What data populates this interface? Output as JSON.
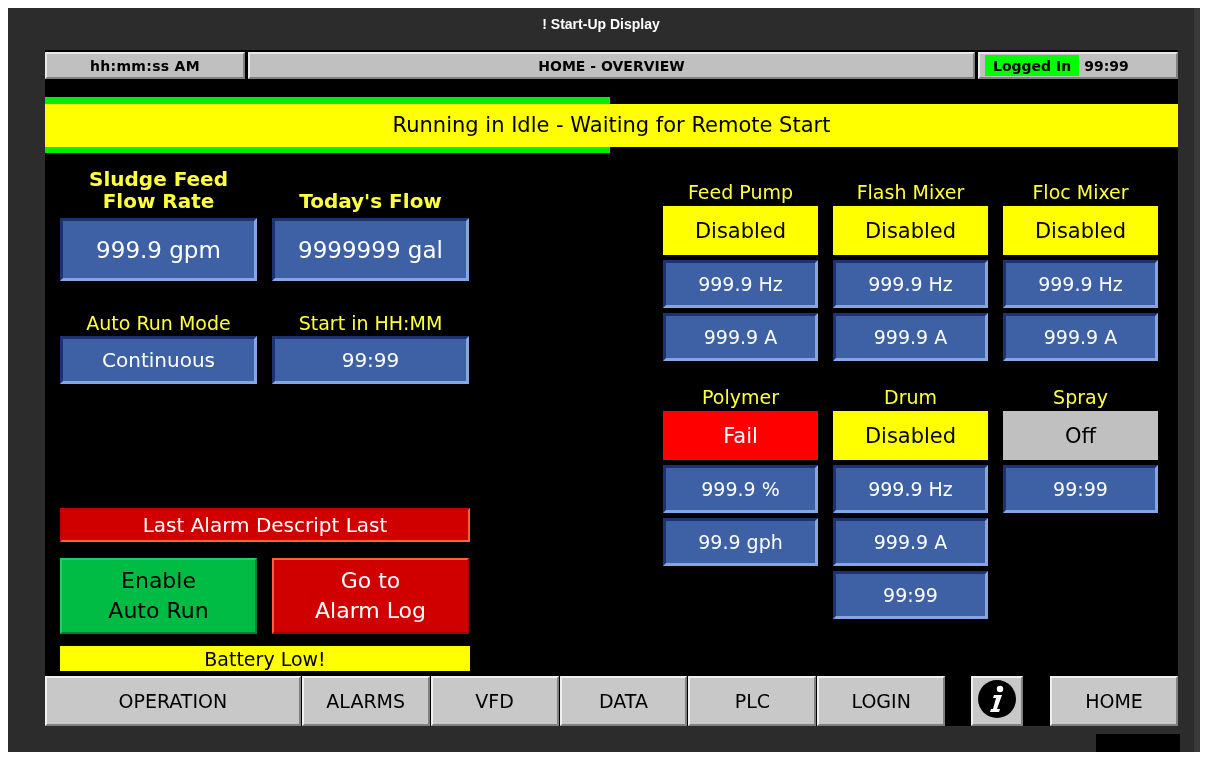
{
  "window": {
    "title": "! Start-Up Display"
  },
  "header": {
    "time": "hh:mm:ss AM",
    "screen_title": "HOME - OVERVIEW",
    "login": {
      "label": "Logged In",
      "on": true
    },
    "timer": "99:99"
  },
  "banner": {
    "message": "Running in Idle - Waiting for Remote Start"
  },
  "readouts": [
    {
      "label": "Sludge Feed\nFlow Rate",
      "value": "999.9 gpm",
      "kind": "large"
    },
    {
      "label": "Today's Flow",
      "value": "9999999 gal",
      "kind": "large"
    },
    {
      "label": "Auto Run Mode",
      "value": "Continuous",
      "kind": "small"
    },
    {
      "label": "Start in HH:MM",
      "value": "99:99",
      "kind": "small"
    }
  ],
  "last_alarm": "Last Alarm Descript Last",
  "actions": [
    {
      "label": "Enable\nAuto Run",
      "kind": "enable"
    },
    {
      "label": "Go to\nAlarm Log",
      "kind": "alarm"
    }
  ],
  "warning": "Battery Low!",
  "equipment": [
    {
      "name": "Feed Pump",
      "status": "Disabled",
      "color": "#ffff00",
      "values": [
        "999.9 Hz",
        "999.9 A"
      ]
    },
    {
      "name": "Flash Mixer",
      "status": "Disabled",
      "color": "#ffff00",
      "values": [
        "999.9 Hz",
        "999.9 A"
      ]
    },
    {
      "name": "Floc Mixer",
      "status": "Disabled",
      "color": "#ffff00",
      "values": [
        "999.9 Hz",
        "999.9 A"
      ]
    },
    {
      "name": "Polymer",
      "status": "Fail",
      "color": "#ff0000",
      "values": [
        "999.9 %",
        "99.9 gph"
      ]
    },
    {
      "name": "Drum",
      "status": "Disabled",
      "color": "#ffff00",
      "values": [
        "999.9 Hz",
        "999.9 A",
        "99:99"
      ]
    },
    {
      "name": "Spray",
      "status": "Off",
      "color": "#c0c0c0",
      "values": [
        "99:99"
      ]
    }
  ],
  "nav": [
    {
      "label": "OPERATION",
      "kind": "wide"
    },
    {
      "label": "ALARMS",
      "kind": "normal"
    },
    {
      "label": "VFD",
      "kind": "normal"
    },
    {
      "label": "DATA",
      "kind": "normal"
    },
    {
      "label": "PLC",
      "kind": "normal"
    },
    {
      "label": "LOGIN",
      "kind": "normal"
    },
    {
      "kind": "info"
    },
    {
      "label": "HOME",
      "kind": "home"
    }
  ]
}
